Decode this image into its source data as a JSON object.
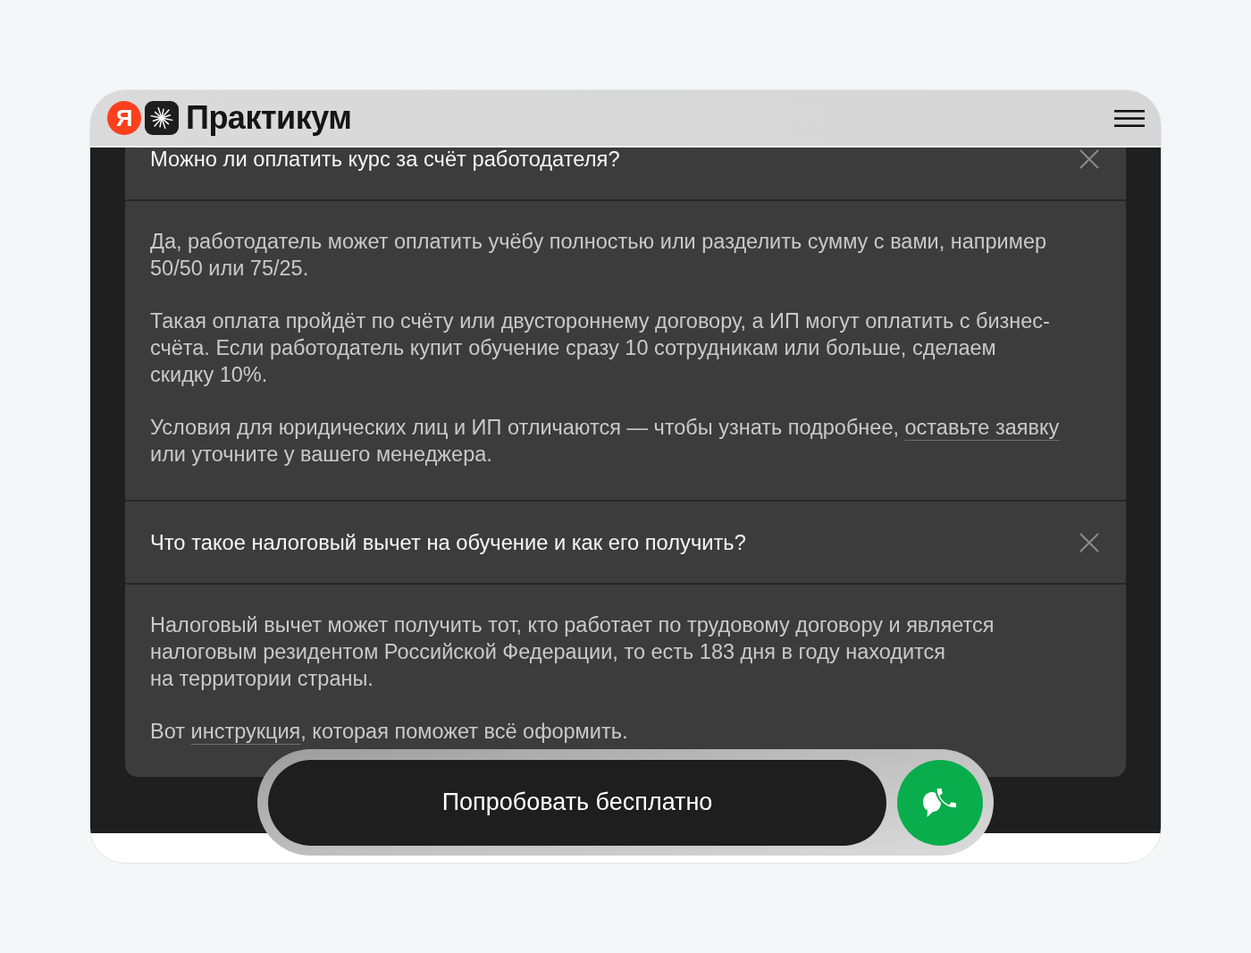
{
  "header": {
    "logo_letter": "Я",
    "logo_text": "Практикум"
  },
  "faq": [
    {
      "question": "Можно ли оплатить курс за счёт работодателя?",
      "expanded": true,
      "answer": [
        {
          "parts": [
            {
              "kind": "text",
              "text": "Да, работодатель может оплатить учёбу полностью или разделить сумму с вами, например 50/50 или 75/25."
            }
          ]
        },
        {
          "parts": [
            {
              "kind": "text",
              "text": "Такая оплата пройдёт по счёту или двустороннему договору, а ИП могут оплатить с бизнес-счёта. Если работодатель купит обучение сразу 10 сотрудникам или больше, сделаем скидку 10%."
            }
          ]
        },
        {
          "parts": [
            {
              "kind": "text",
              "text": "Условия для юридических лиц и ИП отличаются — чтобы узнать подробнее, "
            },
            {
              "kind": "link",
              "text": "оставьте заявку"
            },
            {
              "kind": "text",
              "text": " или уточните у вашего менеджера."
            }
          ]
        }
      ]
    },
    {
      "question": "Что такое налоговый вычет на обучение и как его получить?",
      "expanded": true,
      "answer": [
        {
          "parts": [
            {
              "kind": "text",
              "text": "Налоговый вычет может получить тот, кто работает по трудовому договору и является налоговым резидентом Российской Федерации, то есть 183 дня в году находится на территории страны."
            }
          ]
        },
        {
          "parts": [
            {
              "kind": "text",
              "text": "Вот "
            },
            {
              "kind": "link",
              "text": "инструкция"
            },
            {
              "kind": "text",
              "text": ", которая поможет всё оформить."
            }
          ]
        }
      ]
    }
  ],
  "cta": {
    "label": "Попробовать бесплатно"
  }
}
